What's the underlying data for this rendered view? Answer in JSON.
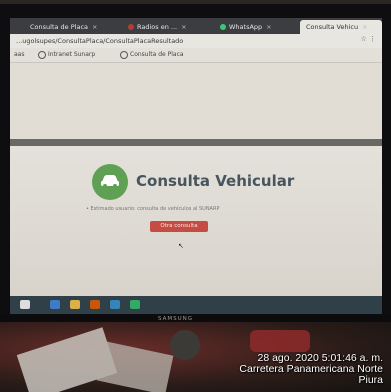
{
  "browser": {
    "tabs": [
      {
        "label": "Consulta de Placa",
        "close": "×"
      },
      {
        "label": "Radios en ...",
        "close": "×"
      },
      {
        "label": "WhatsApp",
        "close": "×"
      },
      {
        "label": "Consulta Vehicu",
        "close": "×"
      }
    ],
    "url": "...ugolsupes/ConsultaPlaca/ConsultaPlacaResultado",
    "bookmarks": [
      {
        "label": "aas"
      },
      {
        "label": "Intranet Sunarp"
      },
      {
        "label": "Consulta de Placa"
      }
    ]
  },
  "page": {
    "brand_title": "Consulta Vehicular",
    "subtitle": "• Estimado usuario: consulta de vehículos al SUNARP",
    "button_label": "Otra consulta"
  },
  "monitor": {
    "brand": "SAMSUNG"
  },
  "timestamp": {
    "line1": "28 ago. 2020 5:01:46 a. m.",
    "line2": "Carretera Panamericana Norte",
    "line3": "Piura"
  },
  "colors": {
    "brand_green": "#5aa24e",
    "button_red": "#d0483f",
    "brand_text": "#46555f"
  }
}
